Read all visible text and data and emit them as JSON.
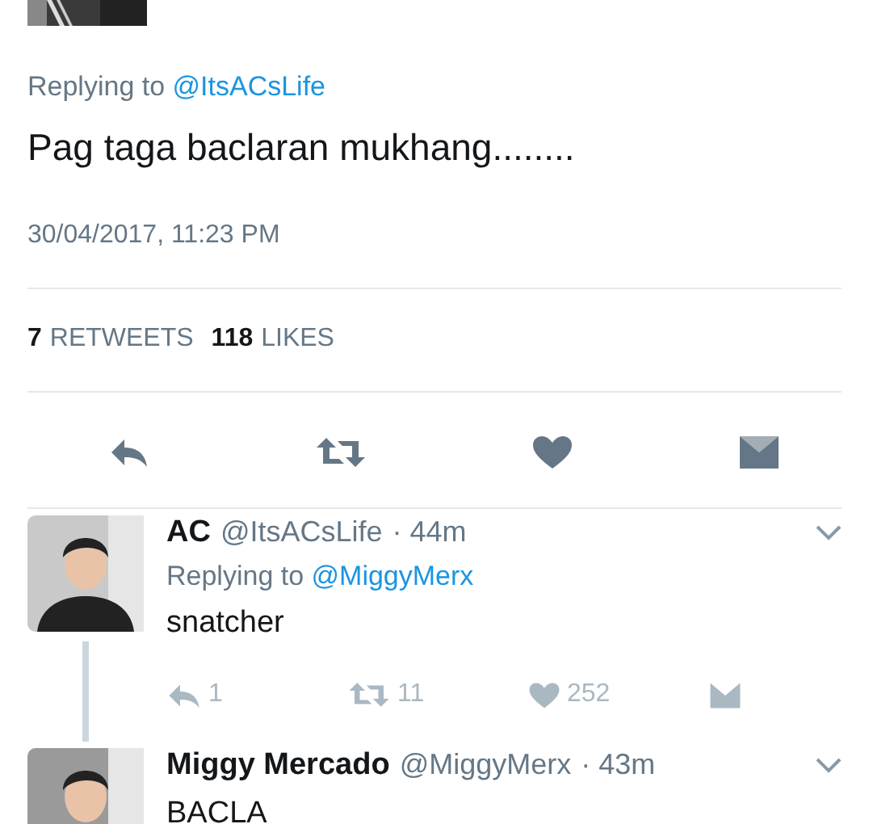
{
  "main_tweet": {
    "replying_to_label": "Replying to",
    "replying_to_handle": "@ItsACsLife",
    "text": "Pag taga baclaran mukhang........",
    "timestamp": "30/04/2017, 11:23 PM",
    "retweets_count": "7",
    "retweets_label": "RETWEETS",
    "likes_count": "118",
    "likes_label": "LIKES"
  },
  "replies": [
    {
      "name": "AC",
      "handle": "@ItsACsLife",
      "time": "· 44m",
      "replying_to_label": "Replying to",
      "replying_to_handle": "@MiggyMerx",
      "text": "snatcher",
      "reply_count": "1",
      "retweet_count": "11",
      "like_count": "252",
      "thread_line": true
    },
    {
      "name": "Miggy Mercado",
      "handle": "@MiggyMerx",
      "time": "· 43m",
      "text": "BACLA",
      "thread_line": false
    }
  ]
}
